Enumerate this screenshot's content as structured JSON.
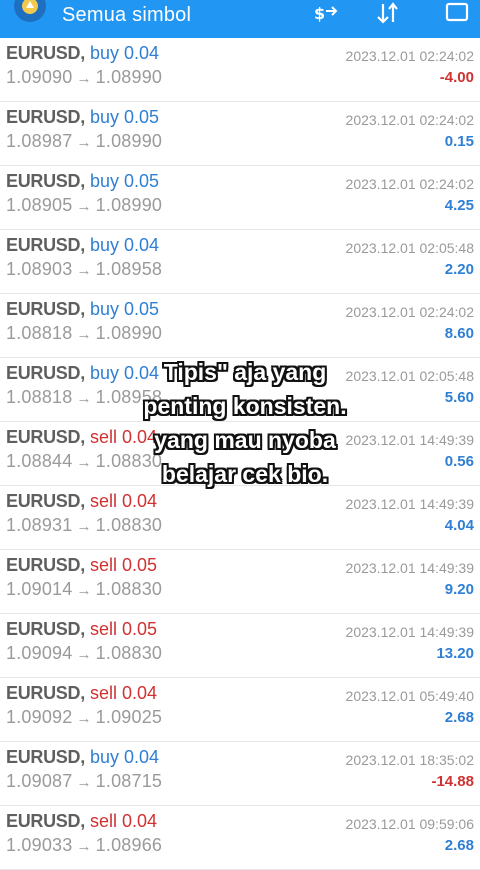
{
  "header": {
    "title": "Semua simbol",
    "accent": "#2196F3"
  },
  "trades": [
    {
      "symbol": "EURUSD,",
      "type": "buy",
      "volume": "0.04",
      "open": "1.09090",
      "close": "1.08990",
      "time": "2023.12.01 02:24:02",
      "profit": "-4.00"
    },
    {
      "symbol": "EURUSD,",
      "type": "buy",
      "volume": "0.05",
      "open": "1.08987",
      "close": "1.08990",
      "time": "2023.12.01 02:24:02",
      "profit": "0.15"
    },
    {
      "symbol": "EURUSD,",
      "type": "buy",
      "volume": "0.05",
      "open": "1.08905",
      "close": "1.08990",
      "time": "2023.12.01 02:24:02",
      "profit": "4.25"
    },
    {
      "symbol": "EURUSD,",
      "type": "buy",
      "volume": "0.04",
      "open": "1.08903",
      "close": "1.08958",
      "time": "2023.12.01 02:05:48",
      "profit": "2.20"
    },
    {
      "symbol": "EURUSD,",
      "type": "buy",
      "volume": "0.05",
      "open": "1.08818",
      "close": "1.08990",
      "time": "2023.12.01 02:24:02",
      "profit": "8.60"
    },
    {
      "symbol": "EURUSD,",
      "type": "buy",
      "volume": "0.04",
      "open": "1.08818",
      "close": "1.08958",
      "time": "2023.12.01 02:05:48",
      "profit": "5.60"
    },
    {
      "symbol": "EURUSD,",
      "type": "sell",
      "volume": "0.04",
      "open": "1.08844",
      "close": "1.08830",
      "time": "2023.12.01 14:49:39",
      "profit": "0.56"
    },
    {
      "symbol": "EURUSD,",
      "type": "sell",
      "volume": "0.04",
      "open": "1.08931",
      "close": "1.08830",
      "time": "2023.12.01 14:49:39",
      "profit": "4.04"
    },
    {
      "symbol": "EURUSD,",
      "type": "sell",
      "volume": "0.05",
      "open": "1.09014",
      "close": "1.08830",
      "time": "2023.12.01 14:49:39",
      "profit": "9.20"
    },
    {
      "symbol": "EURUSD,",
      "type": "sell",
      "volume": "0.05",
      "open": "1.09094",
      "close": "1.08830",
      "time": "2023.12.01 14:49:39",
      "profit": "13.20"
    },
    {
      "symbol": "EURUSD,",
      "type": "sell",
      "volume": "0.04",
      "open": "1.09092",
      "close": "1.09025",
      "time": "2023.12.01 05:49:40",
      "profit": "2.68"
    },
    {
      "symbol": "EURUSD,",
      "type": "buy",
      "volume": "0.04",
      "open": "1.09087",
      "close": "1.08715",
      "time": "2023.12.01 18:35:02",
      "profit": "-14.88"
    },
    {
      "symbol": "EURUSD,",
      "type": "sell",
      "volume": "0.04",
      "open": "1.09033",
      "close": "1.08966",
      "time": "2023.12.01 09:59:06",
      "profit": "2.68"
    }
  ],
  "caption": {
    "lines": [
      "Tipis\" aja yang",
      "penting konsisten.",
      "yang mau nyoba",
      "belajar cek bio."
    ]
  },
  "colors": {
    "buy": "#2f7fd4",
    "sell": "#d03232",
    "profit_positive": "#2f7fd4",
    "profit_negative": "#d03232"
  }
}
